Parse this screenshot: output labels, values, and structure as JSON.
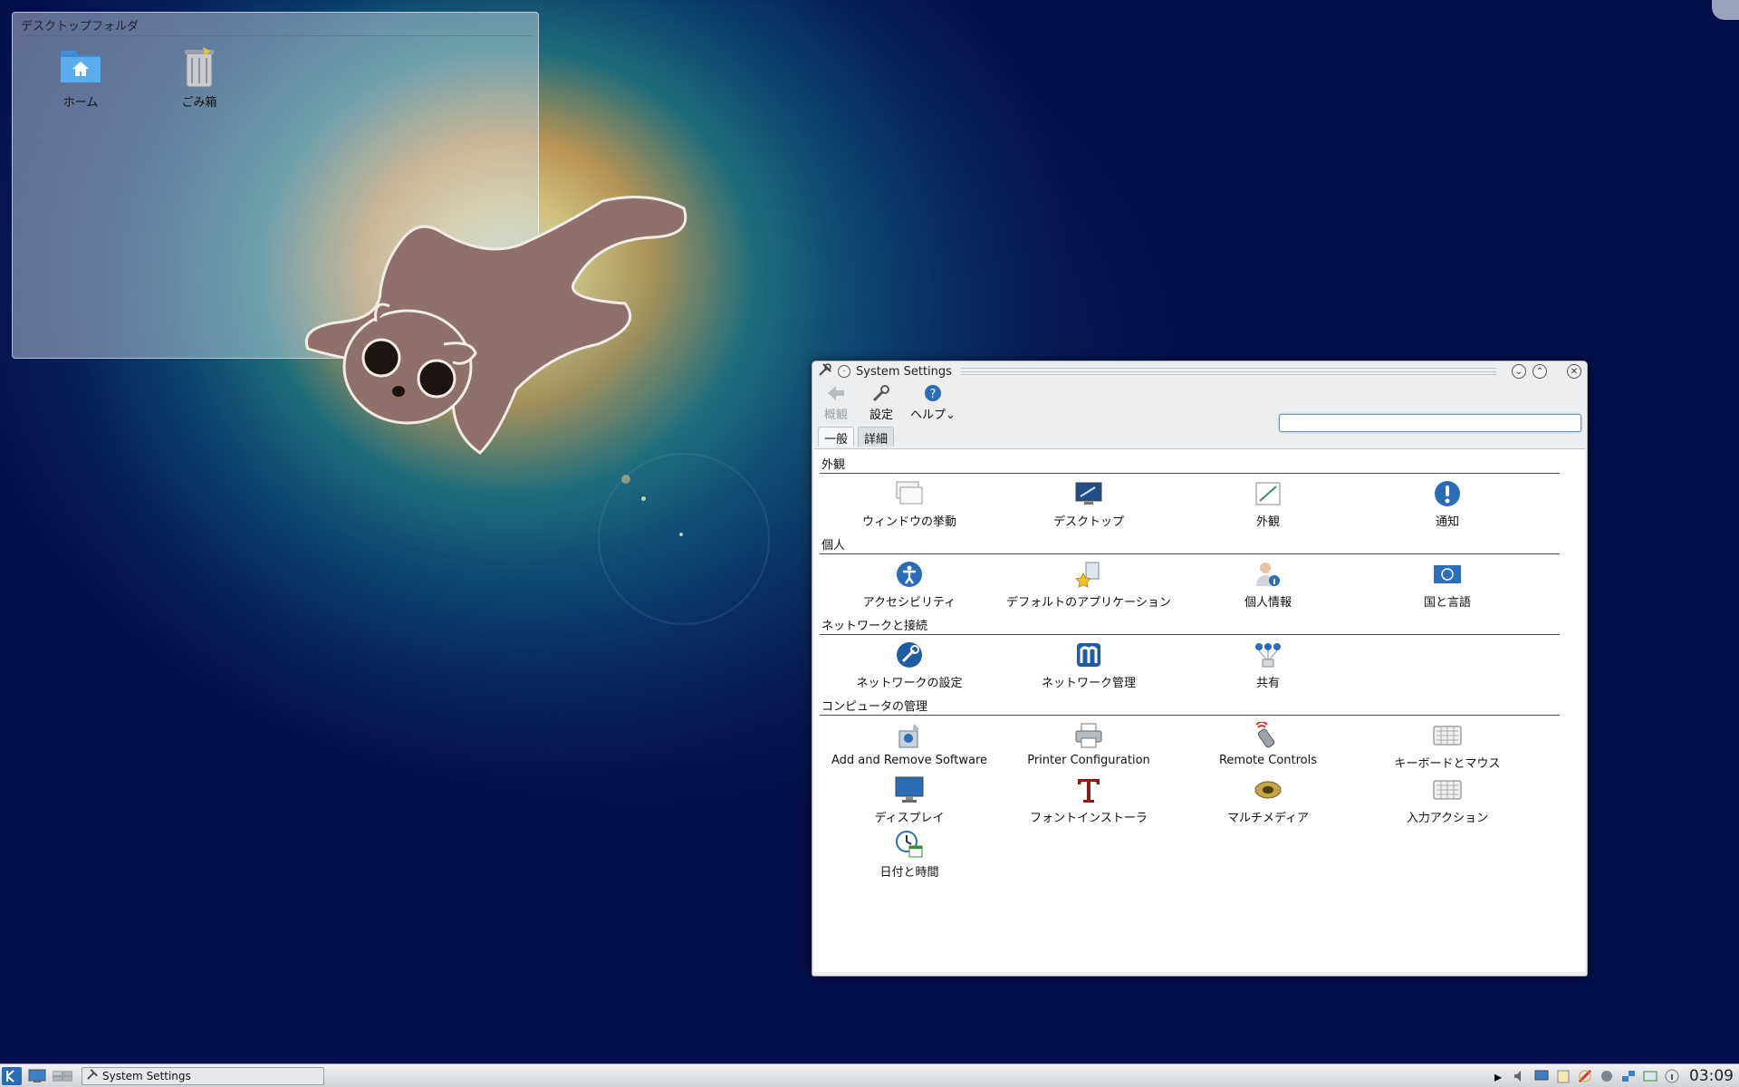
{
  "desktop_folder": {
    "title": "デスクトップフォルダ",
    "icons": [
      {
        "label": "ホーム",
        "icon": "home-folder-icon"
      },
      {
        "label": "ごみ箱",
        "icon": "trash-icon"
      }
    ]
  },
  "window": {
    "title": "System Settings",
    "toolbar": {
      "back_label": "概観",
      "configure_label": "設定",
      "help_label": "ヘルプ",
      "search_placeholder": ""
    },
    "tabs": [
      {
        "label": "一般",
        "active": true
      },
      {
        "label": "詳細",
        "active": false
      }
    ],
    "sections": [
      {
        "title": "外観",
        "items": [
          {
            "label": "ウィンドウの挙動",
            "icon": "window-behavior-icon"
          },
          {
            "label": "デスクトップ",
            "icon": "desktop-icon"
          },
          {
            "label": "外観",
            "icon": "appearance-icon"
          },
          {
            "label": "通知",
            "icon": "notification-icon"
          }
        ]
      },
      {
        "title": "個人",
        "items": [
          {
            "label": "アクセシビリティ",
            "icon": "accessibility-icon"
          },
          {
            "label": "デフォルトのアプリケーション",
            "icon": "default-applications-icon"
          },
          {
            "label": "個人情報",
            "icon": "personal-info-icon"
          },
          {
            "label": "国と言語",
            "icon": "locale-icon"
          }
        ]
      },
      {
        "title": "ネットワークと接続",
        "items": [
          {
            "label": "ネットワークの設定",
            "icon": "network-settings-icon"
          },
          {
            "label": "ネットワーク管理",
            "icon": "network-management-icon"
          },
          {
            "label": "共有",
            "icon": "sharing-icon"
          }
        ]
      },
      {
        "title": "コンピュータの管理",
        "items": [
          {
            "label": "Add and Remove Software",
            "icon": "software-icon"
          },
          {
            "label": "Printer Configuration",
            "icon": "printer-icon"
          },
          {
            "label": "Remote Controls",
            "icon": "remote-control-icon"
          },
          {
            "label": "キーボードとマウス",
            "icon": "keyboard-mouse-icon"
          },
          {
            "label": "ディスプレイ",
            "icon": "display-icon"
          },
          {
            "label": "フォントインストーラ",
            "icon": "font-installer-icon"
          },
          {
            "label": "マルチメディア",
            "icon": "multimedia-icon"
          },
          {
            "label": "入力アクション",
            "icon": "input-actions-icon"
          },
          {
            "label": "日付と時間",
            "icon": "date-time-icon"
          }
        ]
      }
    ]
  },
  "taskbar": {
    "task_label": "System Settings",
    "clock": "03:09"
  },
  "colors": {
    "desktop_bg": "#040e4a",
    "window_bg": "#eceeef",
    "accent": "#2a6db5"
  }
}
